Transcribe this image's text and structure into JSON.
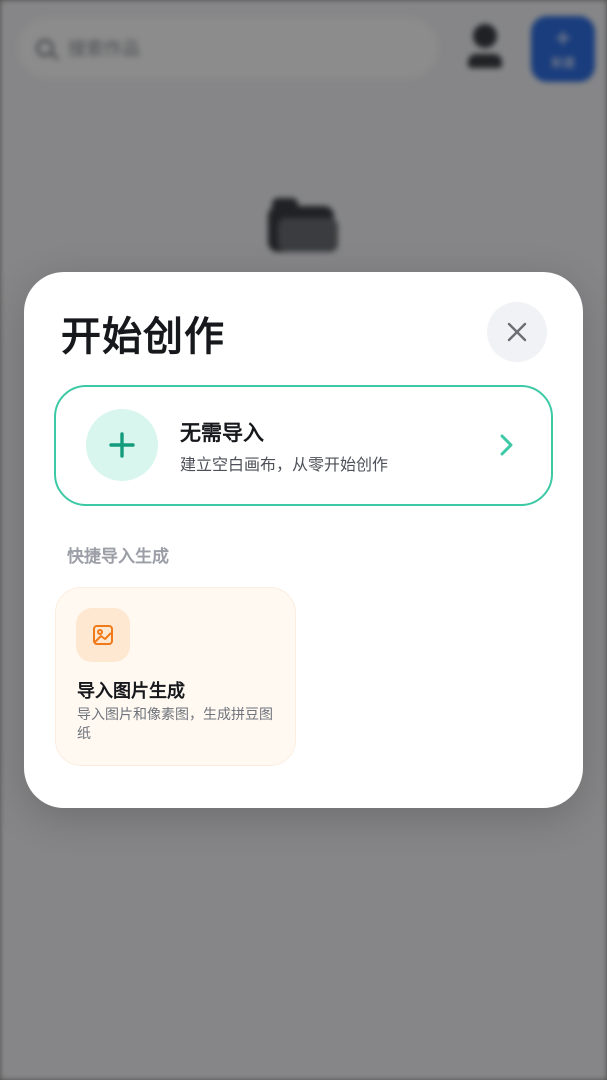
{
  "background": {
    "search_placeholder": "搜索作品",
    "new_button_label": "新建"
  },
  "dialog": {
    "title": "开始创作",
    "close_icon": "close-icon",
    "blank_option": {
      "title": "无需导入",
      "subtitle": "建立空白画布，从零开始创作",
      "icon": "plus-icon",
      "accent_color": "#3dc9a6"
    },
    "section_label": "快捷导入生成",
    "quick_options": [
      {
        "title": "导入图片生成",
        "description": "导入图片和像素图，生成拼豆图纸",
        "icon": "image-icon",
        "accent_color": "#f07a1a"
      }
    ]
  }
}
